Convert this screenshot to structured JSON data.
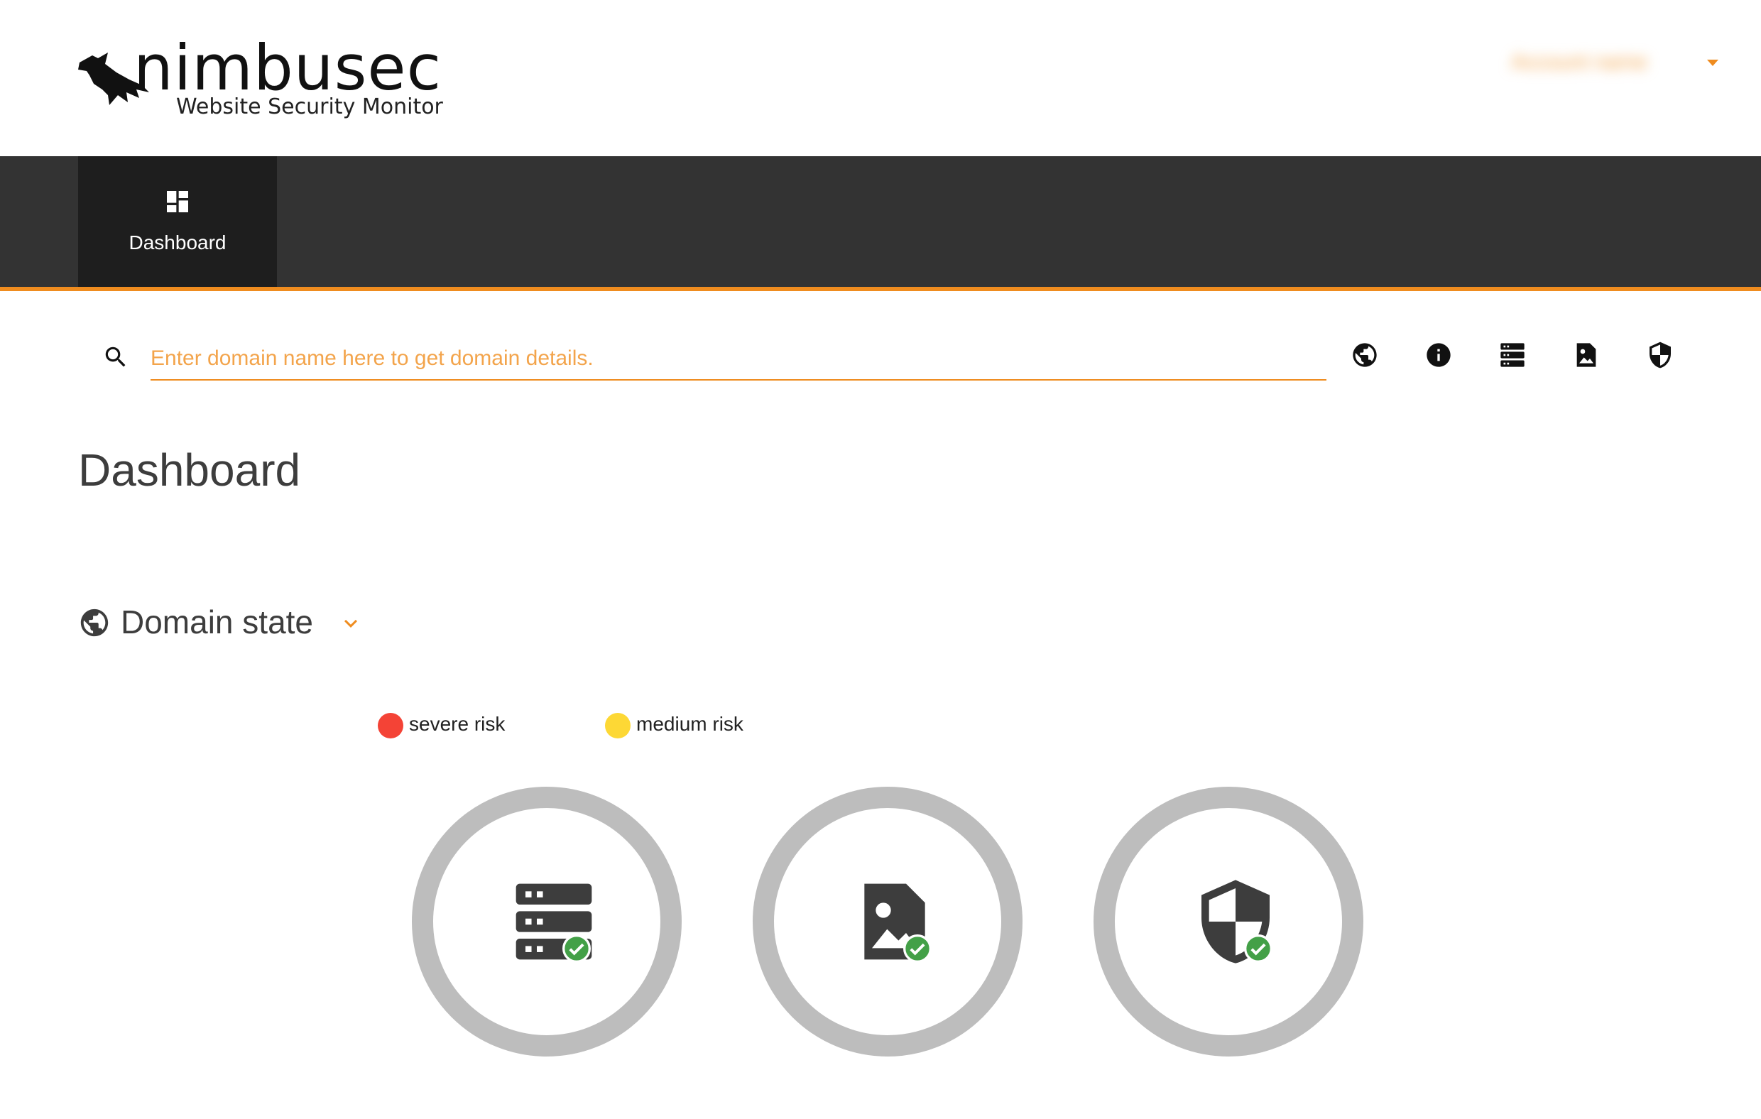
{
  "header": {
    "brand_name": "nimbusec",
    "tagline": "Website Security Monitor",
    "user_name": "Account name"
  },
  "nav": {
    "items": [
      {
        "label": "Dashboard",
        "icon": "dashboard-icon",
        "active": true
      }
    ]
  },
  "search": {
    "placeholder": "Enter domain name here to get domain details.",
    "value": ""
  },
  "toolbar": {
    "icons": [
      "globe-icon",
      "info-icon",
      "server-icon",
      "image-icon",
      "shield-icon"
    ]
  },
  "page": {
    "title": "Dashboard"
  },
  "section": {
    "title": "Domain state",
    "icon": "globe-icon",
    "legend": [
      {
        "label": "severe risk",
        "color": "#f44336"
      },
      {
        "label": "medium risk",
        "color": "#fdd835"
      }
    ],
    "status_rings": [
      {
        "icon": "server-icon",
        "status": "ok"
      },
      {
        "icon": "image-icon",
        "status": "ok"
      },
      {
        "icon": "shield-icon",
        "status": "ok"
      }
    ]
  },
  "colors": {
    "accent": "#ef8c1f",
    "navbar": "#333333",
    "nav_active": "#1e1e1e",
    "ring": "#bdbdbd",
    "ok": "#43a047",
    "icon_dark": "#3d3d3d"
  }
}
